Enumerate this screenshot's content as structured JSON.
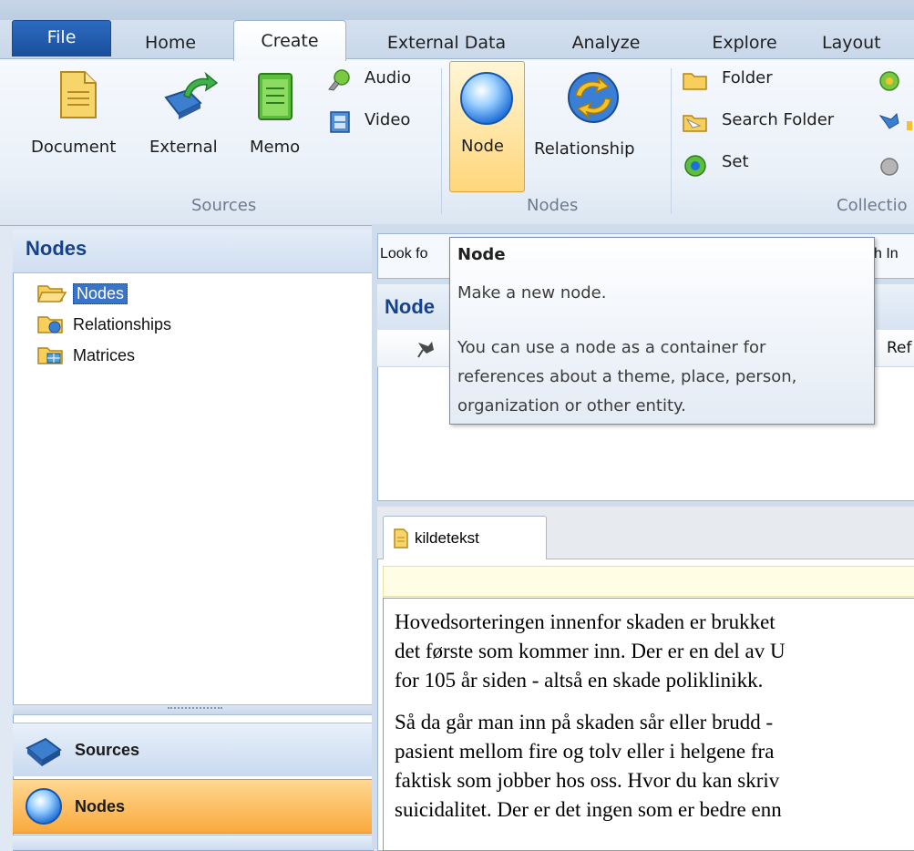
{
  "ribbon_tabs": {
    "file": "File",
    "home": "Home",
    "create": "Create",
    "external_data": "External Data",
    "analyze": "Analyze",
    "explore": "Explore",
    "layout": "Layout"
  },
  "ribbon": {
    "sources": {
      "document": "Document",
      "external": "External",
      "memo": "Memo",
      "audio": "Audio",
      "video": "Video",
      "group_label": "Sources"
    },
    "nodes": {
      "node": "Node",
      "relationship": "Relationship",
      "group_label": "Nodes"
    },
    "collections": {
      "folder": "Folder",
      "search_folder": "Search Folder",
      "set": "Set",
      "group_label": "Collectio"
    }
  },
  "left_pane": {
    "title": "Nodes",
    "tree": [
      "Nodes",
      "Relationships",
      "Matrices"
    ],
    "nav": {
      "sources": "Sources",
      "nodes": "Nodes"
    }
  },
  "find_bar": {
    "look_for": "Look fo",
    "search_in": "ch In"
  },
  "list_panel": {
    "title": "Node",
    "col_ref": "Ref"
  },
  "tooltip": {
    "title": "Node",
    "line1": "Make a new node.",
    "line2": "You can use a node as a container for",
    "line3": "references about a theme, place, person,",
    "line4": "organization or other entity."
  },
  "document": {
    "tab": "kildetekst",
    "para1": [
      "Hovedsorteringen innenfor skaden er brukket",
      "det første som kommer inn. Der er en del av U",
      "for 105 år siden - altså en skade poliklinikk."
    ],
    "para2": [
      "Så da går man inn på skaden sår eller brudd -",
      "pasient mellom fire og tolv eller i helgene fra",
      "faktisk som jobber hos oss. Hvor du kan skriv",
      "suicidalitet. Der er det ingen som er bedre enn"
    ]
  },
  "colors": {
    "file_tab": "#1f5aa8",
    "nav_selected": "#fbb34a",
    "tooltip_border": "#768ca8"
  }
}
